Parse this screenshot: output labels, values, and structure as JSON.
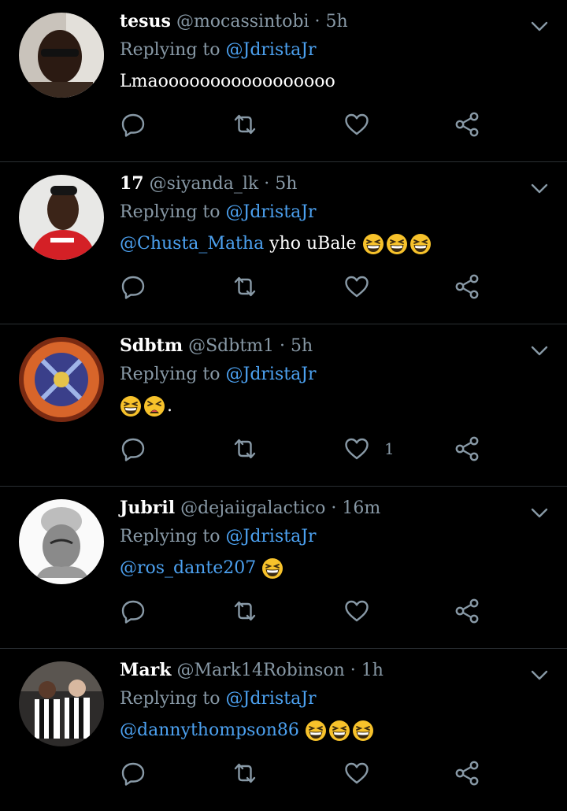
{
  "colors": {
    "background": "#000000",
    "text": "#ffffff",
    "muted": "#8899a6",
    "link": "#4ca1f0",
    "divider": "#2a2f33"
  },
  "tweets": [
    {
      "name": "tesus",
      "handle": "@mocassintobi",
      "separator": "·",
      "time": "5h",
      "replying_prefix": "Replying to",
      "replying_to": "@JdristaJr",
      "mention": "",
      "text": "Lmaooooooooooooooooo",
      "emojis": [],
      "like_count": "",
      "avatar_icon": "avatar-photo-person"
    },
    {
      "name": "17",
      "handle": "@siyanda_lk",
      "separator": "·",
      "time": "5h",
      "replying_prefix": "Replying to",
      "replying_to": "@JdristaJr",
      "mention": "@Chusta_Matha",
      "text": " yho uBale ",
      "emojis": [
        "grinning-squinting-face",
        "grinning-squinting-face",
        "grinning-squinting-face"
      ],
      "like_count": "",
      "avatar_icon": "avatar-photo-person-red-jersey"
    },
    {
      "name": "Sdbtm",
      "handle": "@Sdbtm1",
      "separator": "·",
      "time": "5h",
      "replying_prefix": "Replying to",
      "replying_to": "@JdristaJr",
      "mention": "",
      "text": ".",
      "emojis": [
        "grinning-squinting-face",
        "tired-face"
      ],
      "like_count": "1",
      "avatar_icon": "avatar-card-art"
    },
    {
      "name": "Jubril",
      "handle": "@dejaiigalactico",
      "separator": "·",
      "time": "16m",
      "replying_prefix": "Replying to",
      "replying_to": "@JdristaJr",
      "mention": "@ros_dante207",
      "text": " ",
      "emojis": [
        "grinning-squinting-face"
      ],
      "like_count": "",
      "avatar_icon": "avatar-sketch-portrait"
    },
    {
      "name": "Mark",
      "handle": "@Mark14Robinson",
      "separator": "·",
      "time": "1h",
      "replying_prefix": "Replying to",
      "replying_to": "@JdristaJr",
      "mention": "@dannythompson86",
      "text": "  ",
      "emojis": [
        "grinning-squinting-face",
        "grinning-squinting-face",
        "grinning-squinting-face"
      ],
      "like_count": "",
      "avatar_icon": "avatar-photo-football-players"
    }
  ]
}
